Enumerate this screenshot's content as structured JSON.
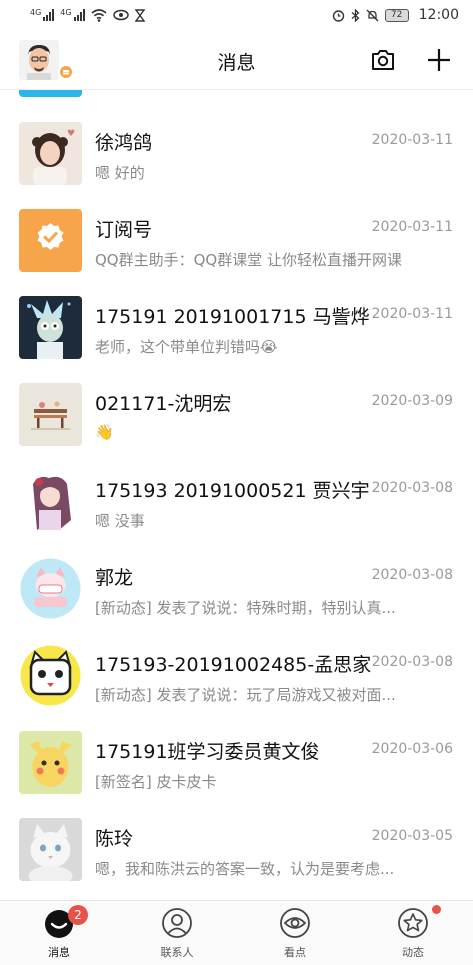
{
  "status_bar": {
    "sim1": "4G",
    "sim2": "4G",
    "battery": "72",
    "time": "12:00"
  },
  "header": {
    "title": "消息"
  },
  "conversations": [
    {
      "name": "徐鸿鸽",
      "date": "2020-03-11",
      "tag": "",
      "message": "嗯 好的"
    },
    {
      "name": "订阅号",
      "date": "2020-03-11",
      "tag": "",
      "message": "QQ群主助手：QQ群课堂 让你轻松直播开网课"
    },
    {
      "name": "175191 20191001715 马訾烨",
      "date": "2020-03-11",
      "tag": "",
      "message": "老师，这个带单位判错吗😭"
    },
    {
      "name": "021171-沈明宏",
      "date": "2020-03-09",
      "tag": "",
      "message": "👋"
    },
    {
      "name": "175193 20191000521 贾兴宇",
      "date": "2020-03-08",
      "tag": "",
      "message": "嗯 没事"
    },
    {
      "name": "郭龙",
      "date": "2020-03-08",
      "tag": "[新动态]",
      "message": " 发表了说说：特殊时期，特别认真..."
    },
    {
      "name": "175193-20191002485-孟思家",
      "date": "2020-03-08",
      "tag": "[新动态]",
      "message": " 发表了说说：玩了局游戏又被对面..."
    },
    {
      "name": "175191班学习委员黄文俊",
      "date": "2020-03-06",
      "tag": "[新签名]",
      "message": " 皮卡皮卡"
    },
    {
      "name": "陈玲",
      "date": "2020-03-05",
      "tag": "",
      "message": "嗯，我和陈洪云的答案一致，认为是要考虑..."
    }
  ],
  "tabs": [
    {
      "label": "消息",
      "badge": "2",
      "active": true
    },
    {
      "label": "联系人"
    },
    {
      "label": "看点"
    },
    {
      "label": "动态",
      "dot": true
    }
  ],
  "colors": {
    "accent_blue": "#29b6e8",
    "subscription_orange": "#f6a54a",
    "badge_red": "#e9524a"
  },
  "icons": {
    "header_left": "camera-icon",
    "header_right": "plus-icon"
  }
}
